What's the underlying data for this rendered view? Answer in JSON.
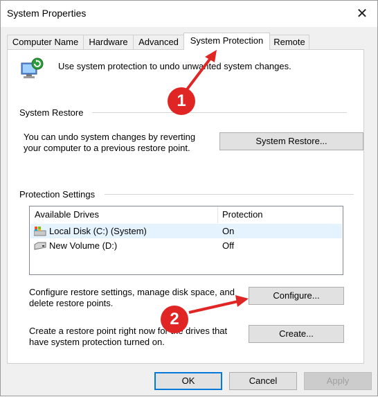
{
  "window": {
    "title": "System Properties"
  },
  "tabs": [
    "Computer Name",
    "Hardware",
    "Advanced",
    "System Protection",
    "Remote"
  ],
  "header": {
    "description": "Use system protection to undo unwanted system changes."
  },
  "system_restore": {
    "group_label": "System Restore",
    "description_line1": "You can undo system changes by reverting",
    "description_line2": "your computer to a previous restore point.",
    "button": "System Restore..."
  },
  "protection": {
    "group_label": "Protection Settings",
    "columns": [
      "Available Drives",
      "Protection"
    ],
    "drives": [
      {
        "name": "Local Disk (C:) (System)",
        "protection": "On",
        "icon": "system-drive-icon"
      },
      {
        "name": "New Volume (D:)",
        "protection": "Off",
        "icon": "drive-icon"
      }
    ],
    "configure_text_line1": "Configure restore settings, manage disk space, and",
    "configure_text_line2": "delete restore points.",
    "configure_button": "Configure...",
    "create_text_line1": "Create a restore point right now for the drives that",
    "create_text_line2": "have system protection turned on.",
    "create_button": "Create..."
  },
  "footer": {
    "ok": "OK",
    "cancel": "Cancel",
    "apply": "Apply"
  },
  "annotations": [
    "1",
    "2"
  ],
  "colors": {
    "annotation_red": "#e02624",
    "selection": "#e5f3ff",
    "focus_border": "#0078d7"
  }
}
